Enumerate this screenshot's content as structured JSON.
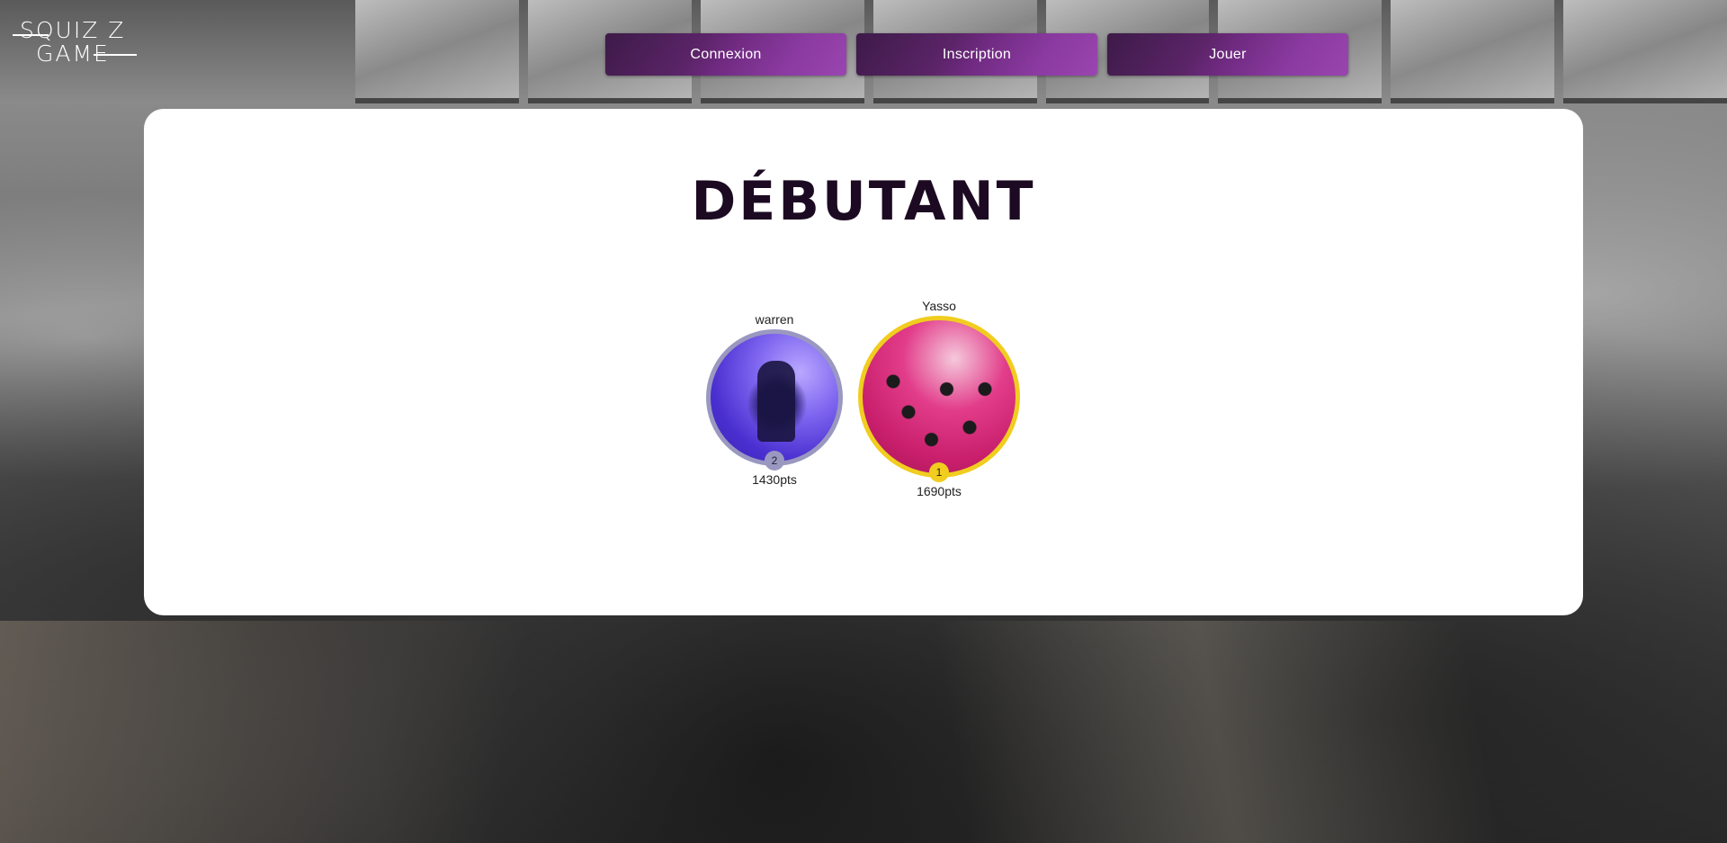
{
  "logo": {
    "line1": "SQUIZ Z",
    "line2": "GAME"
  },
  "nav": {
    "items": [
      {
        "label": "Connexion"
      },
      {
        "label": "Inscription"
      },
      {
        "label": "Jouer"
      }
    ]
  },
  "board": {
    "title": "DÉBUTANT",
    "players": [
      {
        "name": "warren",
        "rank": "2",
        "points": "1430pts",
        "color": "#9a98c0"
      },
      {
        "name": "Yasso",
        "rank": "1",
        "points": "1690pts",
        "color": "#f0cd1f"
      }
    ]
  }
}
